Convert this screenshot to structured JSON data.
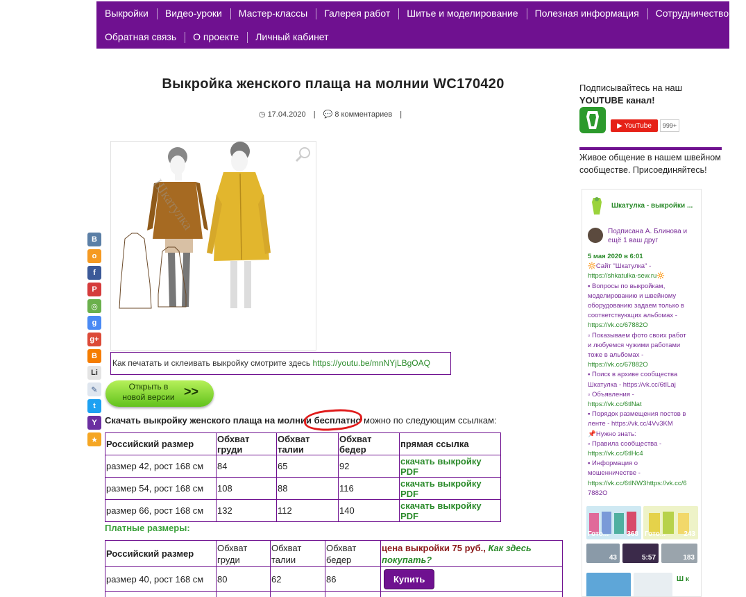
{
  "nav": {
    "row1": [
      "Выкройки",
      "Видео-уроки",
      "Мастер-классы",
      "Галерея работ",
      "Шитье и моделирование",
      "Полезная информация",
      "Сотрудничество"
    ],
    "row2": [
      "Обратная связь",
      "О проекте",
      "Личный кабинет"
    ]
  },
  "article": {
    "title": "Выкройка женского плаща на молнии WC170420",
    "date": "17.04.2020",
    "comments": "8 комментариев"
  },
  "infobox": {
    "text": "Как печатать и склеивать выкройку смотрите здесь ",
    "link": "https://youtu.be/mnNYjLBgOAQ"
  },
  "version_button": {
    "line1": "Открыть в",
    "line2": "новой версии",
    "arrow": ">>"
  },
  "download": {
    "lead": "Скачать выкройку женского плаща на молнии ",
    "free": "бесплатно",
    "tail": " можно по следующим ссылкам:"
  },
  "free_table": {
    "headers": [
      "Российский размер",
      "Обхват груди",
      "Обхват талии",
      "Обхват бедер",
      "прямая ссылка"
    ],
    "rows": [
      [
        "размер 42, рост 168 см",
        "84",
        "65",
        "92",
        "скачать выкройку PDF"
      ],
      [
        "размер 54, рост 168 см",
        "108",
        "88",
        "116",
        "скачать выкройку PDF"
      ],
      [
        "размер 66, рост 168 см",
        "132",
        "112",
        "140",
        "скачать выкройку PDF"
      ]
    ]
  },
  "paid": {
    "heading": "Платные размеры:",
    "headers": [
      "Российский размер",
      "Обхват груди",
      "Обхват талии",
      "Обхват бедер"
    ],
    "price_label": "цена выкройки 75 руб.,",
    "price_link": "Как здесь покупать?",
    "rows": [
      [
        "размер 40, рост 168 см",
        "80",
        "62",
        "86"
      ]
    ],
    "buy_label": "Купить"
  },
  "sidebar": {
    "youtube_text": "Подписывайтесь на наш",
    "youtube_bold": "YOUTUBE канал!",
    "youtube_button": "YouTube",
    "youtube_count": "999+",
    "community_text": "Живое общение в нашем швейном сообществе. Присоединяйтесь!"
  },
  "vk": {
    "group_name": "Шкатулка - выкройки ...",
    "subscribed": "Подписана А. Блинова и ещё 1 ваш друг",
    "post_date": "5 мая 2020 в 6:01",
    "post_lines": [
      "🔆Сайт \"Шкатулка\" -",
      "https://shkatulka-sew.ru🔆",
      "▪ Вопросы по выкройкам,",
      "моделированию и швейному",
      "оборудованию задаем только в",
      "соответствующих альбомах -",
      "https://vk.cc/67882O",
      "▫ Показываем фото своих работ",
      "и любуемся чужими работами",
      "тоже в альбомах -",
      "https://vk.cc/67882O",
      "▪ Поиск в архиве сообщества",
      "Шкатулка - https://vk.cc/6tILaj",
      "▫ Объявления -",
      "https://vk.cc/6tlNat",
      "▪ Порядок размещения постов в",
      "ленте - https://vk.cc/4Vv3KM",
      "📌Нужно знать:",
      "▫ Правила сообщества -",
      "https://vk.cc/6tlHc4",
      "▪ Информация о",
      "мошенничестве -",
      "https://vk.cc/6tINW3https://vk.cc/6",
      "7882O"
    ],
    "thumbs": [
      {
        "cap": "Гото...",
        "num": "368"
      },
      {
        "cap": "Гото...",
        "num": "243"
      },
      {
        "cap": "",
        "num": "43"
      },
      {
        "cap": "",
        "num": "5:57"
      },
      {
        "cap": "",
        "num": "183"
      }
    ],
    "bottom_text": "Ш к"
  },
  "colors": {
    "brand_purple": "#6f1190",
    "link_green": "#2a8a2a",
    "highlight_red": "#e01b1b"
  }
}
